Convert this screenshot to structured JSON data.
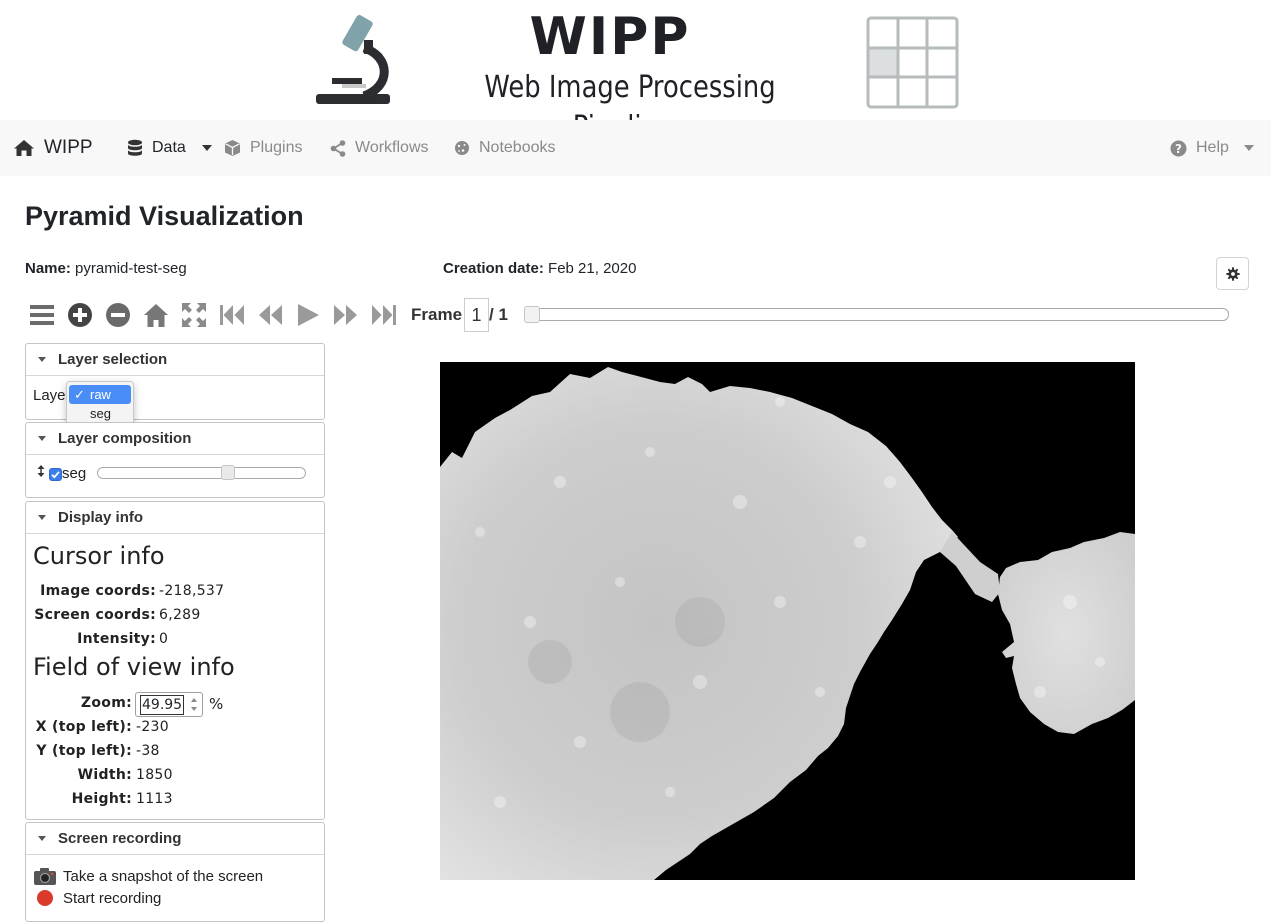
{
  "banner": {
    "title": "WIPP",
    "subtitle": "Web Image Processing Pipelines"
  },
  "navbar": {
    "brand": "WIPP",
    "items": [
      {
        "label": "Data",
        "icon": "database-icon",
        "has_dropdown": true
      },
      {
        "label": "Plugins",
        "icon": "cube-icon"
      },
      {
        "label": "Workflows",
        "icon": "share-icon"
      },
      {
        "label": "Notebooks",
        "icon": "cookie-icon"
      }
    ],
    "help": {
      "label": "Help",
      "icon": "question-circle-icon"
    }
  },
  "page": {
    "title": "Pyramid Visualization",
    "name_label": "Name:",
    "name_value": "pyramid-test-seg",
    "date_label": "Creation date:",
    "date_value": "Feb 21, 2020"
  },
  "toolbar": {
    "frame_label": "Frame",
    "frame_value": "1",
    "frame_total": "/ 1"
  },
  "layer_selection": {
    "title": "Layer selection",
    "label": "Laye",
    "options": [
      "raw",
      "seg"
    ],
    "selected": "raw"
  },
  "layer_composition": {
    "title": "Layer composition",
    "layer_name": "seg",
    "checked": true,
    "opacity": 0.6
  },
  "display_info": {
    "title": "Display info",
    "cursor_heading": "Cursor info",
    "image_coords_label": "Image coords:",
    "image_coords": "-218,537",
    "screen_coords_label": "Screen coords:",
    "screen_coords": "6,289",
    "intensity_label": "Intensity:",
    "intensity": "0",
    "fov_heading": "Field of view info",
    "zoom_label": "Zoom:",
    "zoom": "49.95",
    "zoom_unit": "%",
    "x_label": "X (top left):",
    "x": "-230",
    "y_label": "Y (top left):",
    "y": "-38",
    "width_label": "Width:",
    "width": "1850",
    "height_label": "Height:",
    "height": "1113"
  },
  "screen_recording": {
    "title": "Screen recording",
    "snapshot": "Take a snapshot of the screen",
    "record": "Start recording"
  },
  "colors": {
    "navbar_bg": "#f8f8f8",
    "select_highlight": "#4a8df6",
    "muted": "#8a8a8a"
  }
}
